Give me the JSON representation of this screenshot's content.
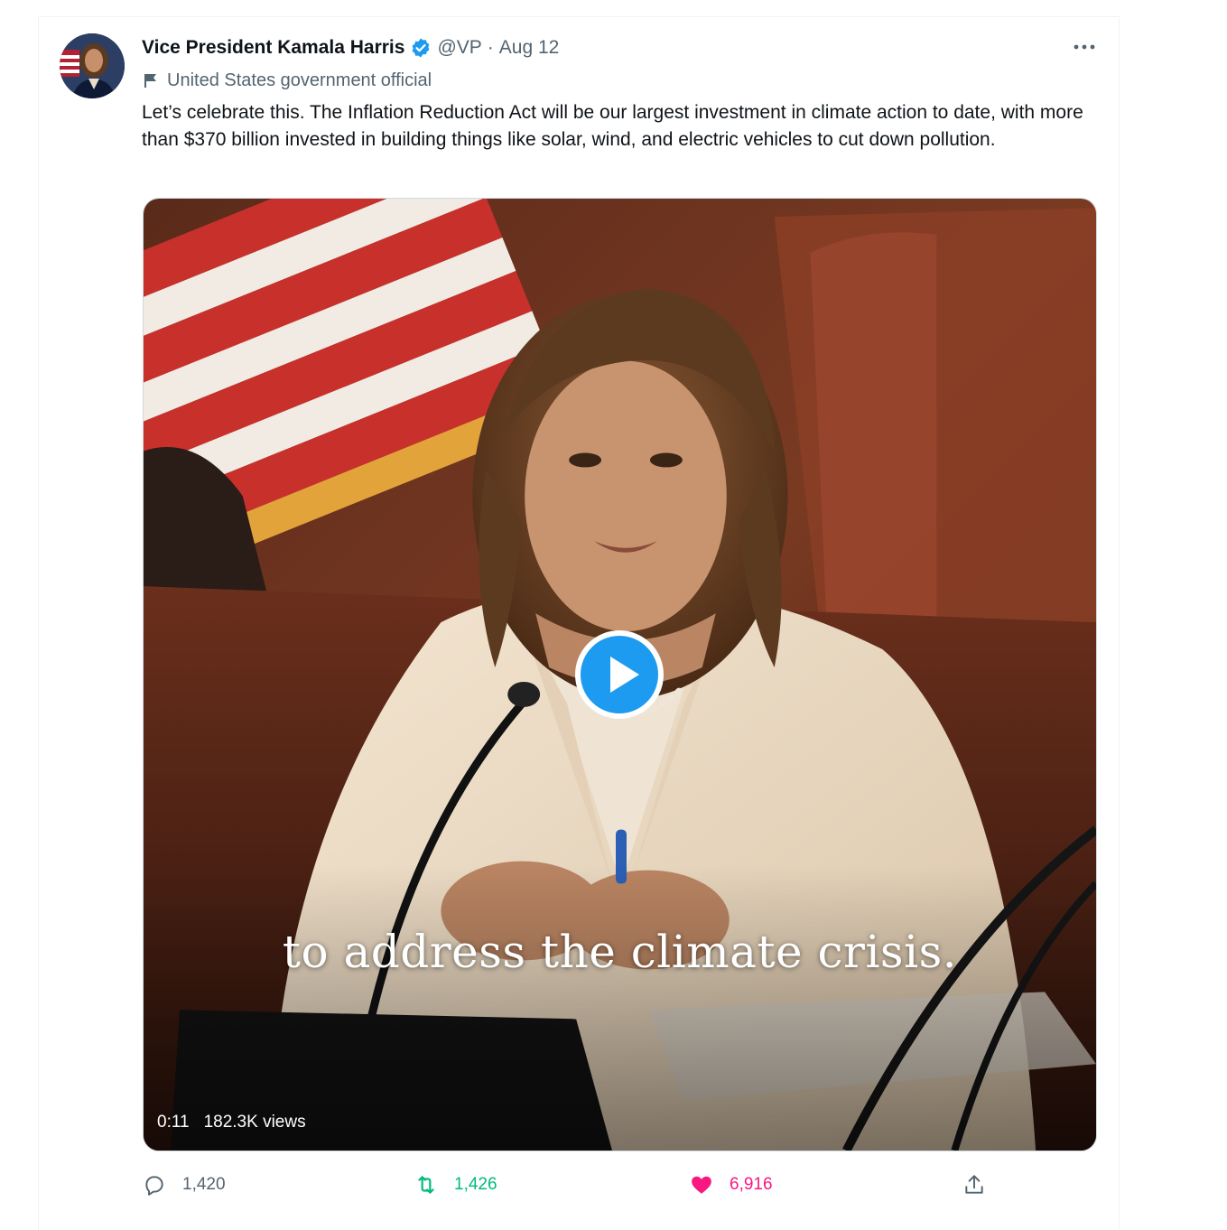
{
  "tweet": {
    "display_name": "Vice President Kamala Harris",
    "handle": "@VP",
    "separator": "·",
    "date": "Aug 12",
    "affiliation": "United States government official",
    "text": "Let’s celebrate this. The Inflation Reduction Act will be our largest investment in climate action to date, with more than $370 billion invested in building things like solar, wind, and electric vehicles to cut down pollution."
  },
  "media": {
    "caption": "to address the climate crisis.",
    "duration": "0:11",
    "views": "182.3K views"
  },
  "actions": {
    "reply_count": "1,420",
    "retweet_count": "1,426",
    "like_count": "6,916"
  },
  "icons": {
    "verified": "verified-badge-icon",
    "more": "more-options-icon",
    "affiliation": "flag-icon",
    "play": "play-icon",
    "reply": "reply-icon",
    "retweet": "retweet-icon",
    "like": "heart-icon",
    "share": "share-icon"
  },
  "colors": {
    "text_primary": "#0f1419",
    "text_secondary": "#536471",
    "verified_blue": "#1d9bf0",
    "retweet_green": "#00ba7c",
    "like_pink": "#f91880"
  }
}
